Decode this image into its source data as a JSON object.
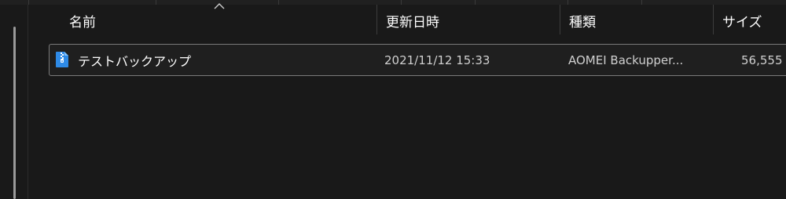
{
  "columns": {
    "name": "名前",
    "modified": "更新日時",
    "type": "種類",
    "size": "サイズ"
  },
  "sort": {
    "column": "name",
    "direction": "ascending"
  },
  "files": [
    {
      "name": "テストバックアップ",
      "modified": "2021/11/12 15:33",
      "type": "AOMEI Backupper...",
      "size": "56,555",
      "icon": "zip-archive-icon"
    }
  ],
  "colors": {
    "background": "#191919",
    "icon_blue": "#2e8ae6",
    "selection_border": "#7a7a7a"
  }
}
